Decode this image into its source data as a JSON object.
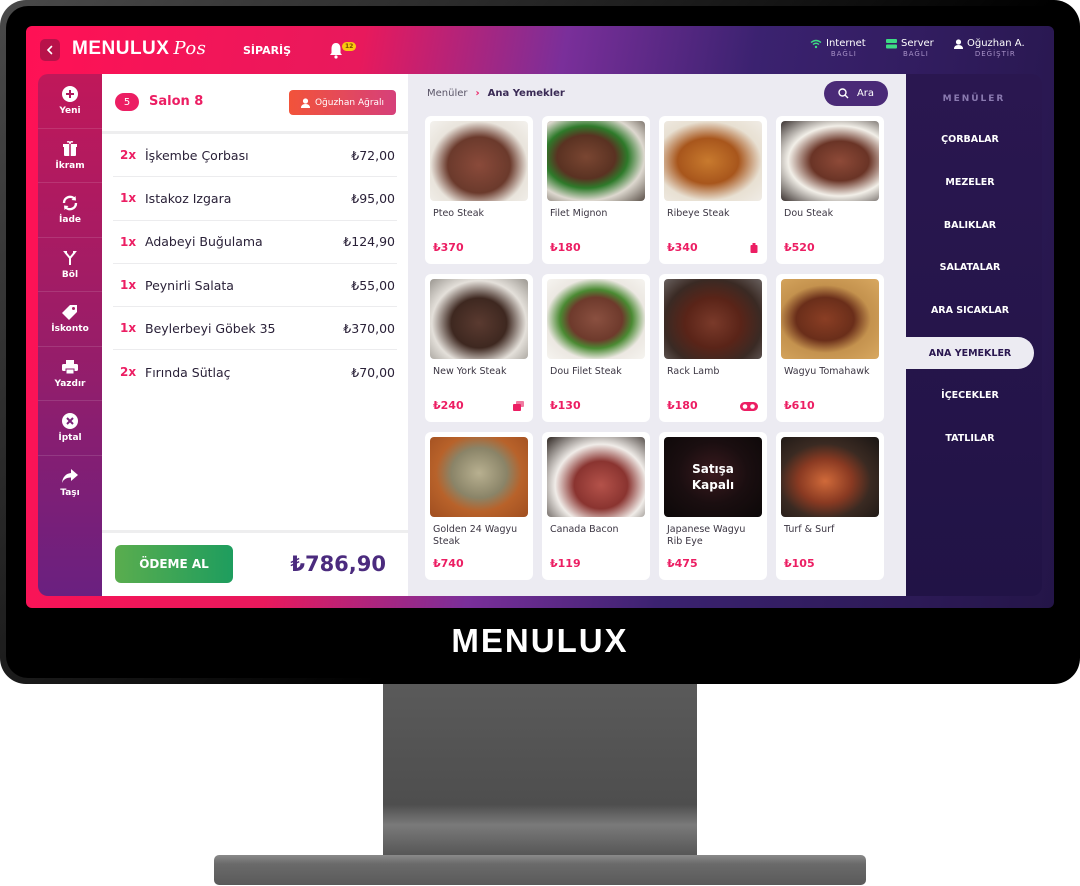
{
  "app": {
    "logo": "MENULUX",
    "logo_suffix": "Pos",
    "nav_order": "SİPARİŞ",
    "notification_count": "12",
    "device_brand": "MENULUX"
  },
  "status": {
    "internet": {
      "label": "Internet",
      "sub": "BAĞLI",
      "color": "#3ddc84"
    },
    "server": {
      "label": "Server",
      "sub": "BAĞLI",
      "color": "#3ddc84"
    },
    "user": {
      "label": "Oğuzhan A.",
      "sub": "DEĞİŞTİR"
    }
  },
  "actions": [
    {
      "label": "Yeni",
      "icon": "plus-circle-icon"
    },
    {
      "label": "İkram",
      "icon": "gift-icon"
    },
    {
      "label": "İade",
      "icon": "refresh-icon"
    },
    {
      "label": "Böl",
      "icon": "split-icon"
    },
    {
      "label": "İskonto",
      "icon": "tag-icon"
    },
    {
      "label": "Yazdır",
      "icon": "printer-icon"
    },
    {
      "label": "İptal",
      "icon": "cancel-circle-icon"
    },
    {
      "label": "Taşı",
      "icon": "share-arrow-icon"
    }
  ],
  "order": {
    "table_number": "5",
    "table_name": "Salon 8",
    "waiter": "Oğuzhan Ağralı",
    "items": [
      {
        "qty": "2x",
        "name": "İşkembe Çorbası",
        "price": "₺72,00"
      },
      {
        "qty": "1x",
        "name": "Istakoz Izgara",
        "price": "₺95,00"
      },
      {
        "qty": "1x",
        "name": "Adabeyi Buğulama",
        "price": "₺124,90"
      },
      {
        "qty": "1x",
        "name": "Peynirli Salata",
        "price": "₺55,00"
      },
      {
        "qty": "1x",
        "name": "Beylerbeyi Göbek 35",
        "price": "₺370,00"
      },
      {
        "qty": "2x",
        "name": "Fırında Sütlaç",
        "price": "₺70,00"
      }
    ],
    "pay_label": "ÖDEME AL",
    "total": "₺786,90"
  },
  "products": {
    "breadcrumb": [
      "Menüler",
      "Ana Yemekler"
    ],
    "search_label": "Ara",
    "items": [
      {
        "name": "Pteo Steak",
        "price": "₺370",
        "badge": null
      },
      {
        "name": "Filet Mignon",
        "price": "₺180",
        "badge": null
      },
      {
        "name": "Ribeye Steak",
        "price": "₺340",
        "badge": "bottle-icon"
      },
      {
        "name": "Dou Steak",
        "price": "₺520",
        "badge": null
      },
      {
        "name": "New York Steak",
        "price": "₺240",
        "badge": "stack-icon"
      },
      {
        "name": "Dou Filet Steak",
        "price": "₺130",
        "badge": null
      },
      {
        "name": "Rack Lamb",
        "price": "₺180",
        "badge": "toggle-icon"
      },
      {
        "name": "Wagyu Tomahawk",
        "price": "₺610",
        "badge": null
      },
      {
        "name": "Golden 24 Wagyu Steak",
        "price": "₺740",
        "badge": null
      },
      {
        "name": "Canada Bacon",
        "price": "₺119",
        "badge": null
      },
      {
        "name": "Japanese Wagyu Rib Eye",
        "price": "₺475",
        "badge": null,
        "closed_label": "Satışa Kapalı"
      },
      {
        "name": "Turf & Surf",
        "price": "₺105",
        "badge": null
      }
    ]
  },
  "categories": {
    "title": "MENÜLER",
    "items": [
      "ÇORBALAR",
      "MEZELER",
      "BALIKLAR",
      "SALATALAR",
      "ARA SICAKLAR",
      "ANA YEMEKLER",
      "İÇECEKLER",
      "TATLILAR"
    ],
    "active": "ANA YEMEKLER"
  },
  "colors": {
    "accent_pink": "#ec1e63",
    "accent_purple": "#4a2a77",
    "pay_green": "#1e9d5e"
  }
}
